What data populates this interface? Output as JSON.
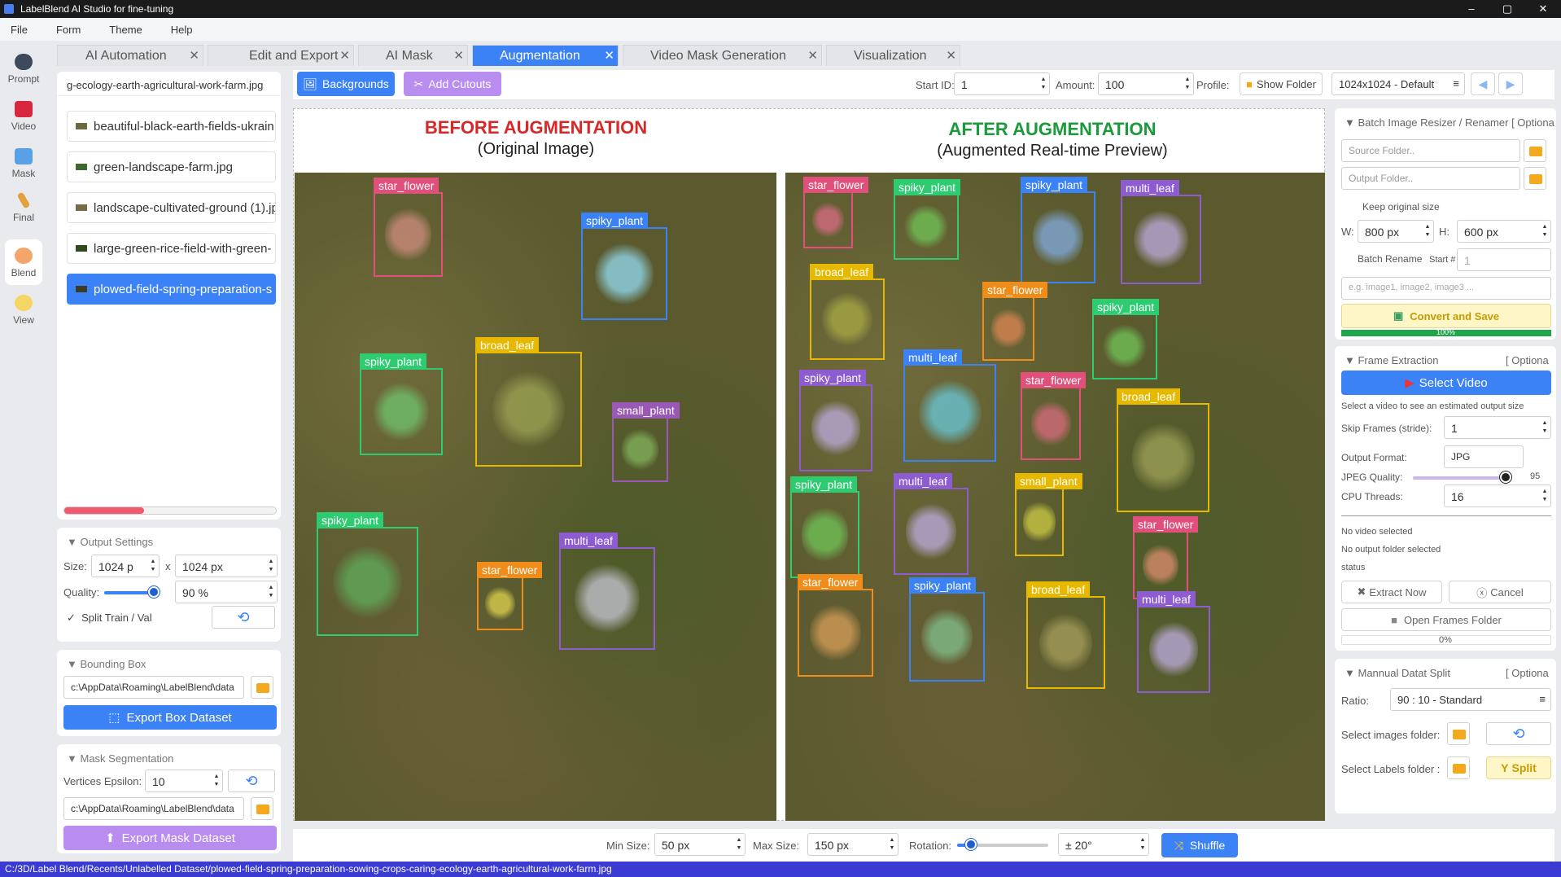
{
  "window": {
    "title": "LabelBlend AI Studio for fine-tuning",
    "controls": [
      "–",
      "▢",
      "✕"
    ]
  },
  "menu": [
    "File",
    "Form",
    "Theme",
    "Help"
  ],
  "nav": [
    {
      "label": "Prompt",
      "icon": "prompt-icon"
    },
    {
      "label": "Video",
      "icon": "video-icon"
    },
    {
      "label": "Mask",
      "icon": "mask-icon"
    },
    {
      "label": "Final",
      "icon": "pencil-icon"
    },
    {
      "label": "Blend",
      "icon": "blend-icon"
    },
    {
      "label": "View",
      "icon": "view-icon"
    }
  ],
  "tabs": [
    {
      "label": "AI Automation",
      "active": false
    },
    {
      "label": "Edit and Export",
      "active": false
    },
    {
      "label": "AI Mask",
      "active": false
    },
    {
      "label": "Augmentation",
      "active": true
    },
    {
      "label": "Video Mask Generation",
      "active": false
    },
    {
      "label": "Visualization",
      "active": false
    }
  ],
  "files": {
    "current": "g-ecology-earth-agricultural-work-farm.jpg",
    "items": [
      "beautiful-black-earth-fields-ukrain",
      "green-landscape-farm.jpg",
      "landscape-cultivated-ground (1).jp",
      "large-green-rice-field-with-green-",
      "plowed-field-spring-preparation-s"
    ],
    "selected_index": 4
  },
  "output_settings": {
    "title": "Output Settings",
    "size_label": "Size:",
    "width": "1024 p",
    "x": "x",
    "height": "1024 px",
    "quality_label": "Quality:",
    "quality": "90 %",
    "quality_value": 0.9,
    "split_label": "Split Train / Val"
  },
  "bounding_box": {
    "title": "Bounding Box",
    "path": "c:\\AppData\\Roaming\\LabelBlend\\data",
    "export_label": "Export Box Dataset"
  },
  "mask_segmentation": {
    "title": "Mask Segmentation",
    "epsilon_label": "Vertices Epsilon:",
    "epsilon": "10",
    "path": "c:\\AppData\\Roaming\\LabelBlend\\data",
    "export_label": "Export Mask Dataset"
  },
  "toolbar": {
    "backgrounds": "Backgrounds",
    "add_cutouts": "Add Cutouts",
    "start_id_label": "Start ID:",
    "start_id": "1",
    "amount_label": "Amount:",
    "amount": "100",
    "profile_label": "Profile:",
    "show_folder": "Show Folder",
    "profile": "1024x1024 - Default"
  },
  "preview": {
    "before_title": "BEFORE AUGMENTATION",
    "before_sub": "(Original Image)",
    "after_title": "AFTER AUGMENTATION",
    "after_sub": "(Augmented Real-time Preview)",
    "before_boxes": [
      "star_flower",
      "spiky_plant",
      "spiky_plant",
      "broad_leaf",
      "small_plant",
      "spiky_plant",
      "star_flower",
      "multi_leaf"
    ],
    "after_boxes": [
      "star_flower",
      "spiky_plant",
      "spiky_plant",
      "multi_leaf",
      "broad_leaf",
      "star_flower",
      "spiky_plant",
      "multi_leaf",
      "spiky_plant",
      "star_flower",
      "broad_leaf",
      "spiky_plant",
      "multi_leaf",
      "small_plant",
      "star_flower",
      "star_flower",
      "spiky_plant",
      "broad_leaf",
      "multi_leaf"
    ],
    "colors": {
      "star_flower": "#e0507a",
      "spiky_plant": "#3b82f6",
      "broad_leaf": "#e6b800",
      "small_plant": "#9b59b6",
      "multi_leaf": "#8e5cd1",
      "spiky_green": "#2ecc71",
      "star_orange": "#f08c1a"
    }
  },
  "resizer": {
    "title": "Batch Image Resizer / Renamer",
    "optional": "[ Optiona",
    "source_placeholder": "Source Folder..",
    "output_placeholder": "Output Folder..",
    "keep_label": "Keep original size",
    "w_label": "W:",
    "w": "800 px",
    "h_label": "H:",
    "h": "600 px",
    "rename_label": "Batch Rename",
    "start_label": "Start #",
    "start": "1",
    "pattern_placeholder": "e.g. image1, image2, image3 ...",
    "convert_label": "Convert and Save",
    "progress": "100%",
    "progress_value": 1.0
  },
  "frames": {
    "title": "Frame Extraction",
    "optional": "[ Optiona",
    "select_video": "Select Video",
    "hint": "Select a video to see an estimated output size",
    "skip_label": "Skip Frames (stride):",
    "skip": "1",
    "format_label": "Output Format:",
    "format": "JPG",
    "quality_label": "JPEG Quality:",
    "quality": "95",
    "quality_value": 0.95,
    "threads_label": "CPU Threads:",
    "threads": "16",
    "no_video": "No video selected",
    "no_output": "No output folder selected",
    "status": "status",
    "extract": "Extract Now",
    "cancel": "Cancel",
    "open_folder": "Open Frames Folder",
    "progress": "0%"
  },
  "split": {
    "title": "Mannual Datat Split",
    "optional": "[ Optiona",
    "ratio_label": "Ratio:",
    "ratio": "90 : 10 - Standard",
    "images_label": "Select images folder:",
    "labels_label": "Select Labels folder :",
    "split_btn": "Split"
  },
  "bottom": {
    "min_label": "Min Size:",
    "min": "50 px",
    "max_label": "Max Size:",
    "max": "150 px",
    "rotation_label": "Rotation:",
    "rotation": "± 20°",
    "rotation_value": 0.15,
    "shuffle": "Shuffle"
  },
  "status_path": "C:/3D/Label Blend/Recents/Unlabelled Dataset/plowed-field-spring-preparation-sowing-crops-caring-ecology-earth-agricultural-work-farm.jpg"
}
